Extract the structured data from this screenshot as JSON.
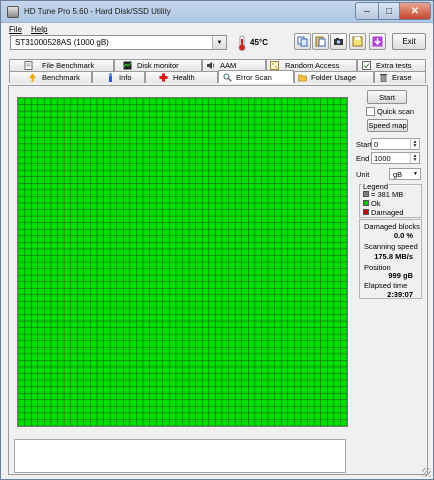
{
  "window": {
    "title": "HD Tune Pro 5.60 - Hard Disk/SSD Utility"
  },
  "menu": {
    "file": "File",
    "help": "Help"
  },
  "toolbar": {
    "drive": "ST31000528AS (1000 gB)",
    "temperature": "45°C",
    "icons": [
      "copy-icon",
      "paste-icon",
      "camera-icon",
      "save-icon",
      "download-icon"
    ],
    "exit_label": "Exit"
  },
  "tabs": {
    "row1": [
      {
        "label": "File Benchmark",
        "icon": "file-benchmark-icon"
      },
      {
        "label": "Disk monitor",
        "icon": "disk-monitor-icon"
      },
      {
        "label": "AAM",
        "icon": "speaker-icon"
      },
      {
        "label": "Random Access",
        "icon": "random-access-icon"
      },
      {
        "label": "Extra tests",
        "icon": "extra-tests-icon"
      }
    ],
    "row2": [
      {
        "label": "Benchmark",
        "icon": "benchmark-icon"
      },
      {
        "label": "Info",
        "icon": "info-icon"
      },
      {
        "label": "Health",
        "icon": "health-cross-icon"
      },
      {
        "label": "Error Scan",
        "icon": "error-scan-icon",
        "active": true
      },
      {
        "label": "Folder Usage",
        "icon": "folder-icon"
      },
      {
        "label": "Erase",
        "icon": "trash-icon"
      }
    ]
  },
  "scan": {
    "start_label": "Start",
    "quick_scan_label": "Quick scan",
    "speed_map_label": "Speed map",
    "start_field_label": "Start",
    "start_value": "0",
    "end_field_label": "End",
    "end_value": "1000",
    "unit_label": "Unit",
    "unit_value": "gB"
  },
  "legend": {
    "title": "Legend",
    "items": [
      {
        "label": "= 381 MB",
        "color": "#7f7f7f"
      },
      {
        "label": "Ok",
        "color": "#00c000"
      },
      {
        "label": "Damaged",
        "color": "#d00000"
      }
    ]
  },
  "stats": {
    "damaged_blocks_label": "Damaged blocks",
    "damaged_blocks_value": "0.0 %",
    "scanning_speed_label": "Scanning speed",
    "scanning_speed_value": "175.8 MB/s",
    "position_label": "Position",
    "position_value": "999 gB",
    "elapsed_label": "Elapsed time",
    "elapsed_value": "2:39:07"
  },
  "block_map": {
    "ok_color": "#00e000",
    "grid_color": "#1f4f1f",
    "damaged_count": 0
  }
}
